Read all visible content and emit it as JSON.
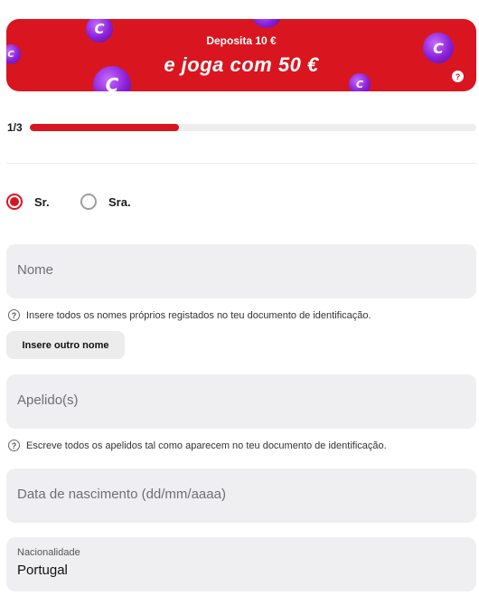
{
  "banner": {
    "line1": "Deposita 10 €",
    "line2": "e joga com 50 €",
    "coin_glyph": "C",
    "help_glyph": "?",
    "color": "#d9161f"
  },
  "progress": {
    "label": "1/3",
    "fraction": 0.333
  },
  "salutation": {
    "options": [
      {
        "label": "Sr.",
        "selected": true
      },
      {
        "label": "Sra.",
        "selected": false
      }
    ]
  },
  "form": {
    "first_name": {
      "placeholder": "Nome",
      "hint": "Insere todos os nomes próprios registados no teu documento de identificação."
    },
    "add_name_button": "Insere outro nome",
    "last_name": {
      "placeholder": "Apelido(s)",
      "hint": "Escreve todos os apelidos tal como aparecem no teu documento de identificação."
    },
    "birth_date": {
      "placeholder": "Data de nascimento (dd/mm/aaaa)"
    },
    "nationality": {
      "label": "Nacionalidade",
      "value": "Portugal"
    }
  },
  "help_icon_glyph": "?"
}
